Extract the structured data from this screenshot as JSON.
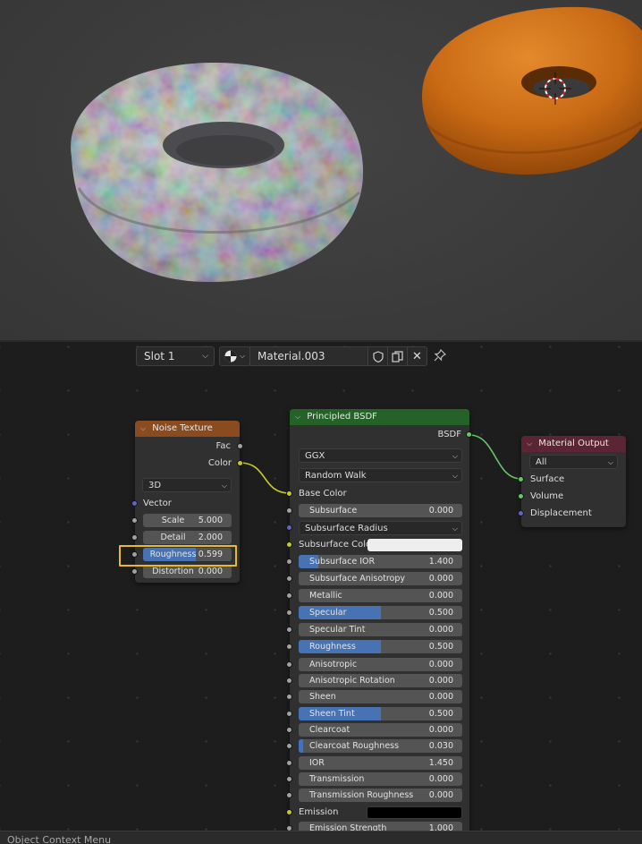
{
  "header": {
    "slot_label": "Slot 1",
    "material_name": "Material.003"
  },
  "noise_texture": {
    "title": "Noise Texture",
    "outputs": [
      "Fac",
      "Color"
    ],
    "dimensions": "3D",
    "vector_label": "Vector",
    "fields": [
      {
        "label": "Scale",
        "value": "5.000",
        "fill": 0
      },
      {
        "label": "Detail",
        "value": "2.000",
        "fill": 0
      },
      {
        "label": "Roughness",
        "value": "0.599",
        "fill": 0.599
      },
      {
        "label": "Distortion",
        "value": "0.000",
        "fill": 0
      }
    ]
  },
  "principled": {
    "title": "Principled BSDF",
    "output": "BSDF",
    "distribution": "GGX",
    "subsurface_method": "Random Walk",
    "base_color_label": "Base Color",
    "subsurface_radius_label": "Subsurface Radius",
    "subsurface_color_label": "Subsurface Color",
    "emission_label": "Emission",
    "fields": [
      {
        "label": "Subsurface",
        "value": "0.000",
        "fill": 0
      },
      {
        "label": "Subsurface IOR",
        "value": "1.400",
        "fill": 0.12
      },
      {
        "label": "Subsurface Anisotropy",
        "value": "0.000",
        "fill": 0
      },
      {
        "label": "Metallic",
        "value": "0.000",
        "fill": 0
      },
      {
        "label": "Specular",
        "value": "0.500",
        "fill": 0.5
      },
      {
        "label": "Specular Tint",
        "value": "0.000",
        "fill": 0
      },
      {
        "label": "Roughness",
        "value": "0.500",
        "fill": 0.5
      },
      {
        "label": "Anisotropic",
        "value": "0.000",
        "fill": 0
      },
      {
        "label": "Anisotropic Rotation",
        "value": "0.000",
        "fill": 0
      },
      {
        "label": "Sheen",
        "value": "0.000",
        "fill": 0
      },
      {
        "label": "Sheen Tint",
        "value": "0.500",
        "fill": 0.5
      },
      {
        "label": "Clearcoat",
        "value": "0.000",
        "fill": 0
      },
      {
        "label": "Clearcoat Roughness",
        "value": "0.030",
        "fill": 0.03
      },
      {
        "label": "IOR",
        "value": "1.450",
        "fill": 0
      },
      {
        "label": "Transmission",
        "value": "0.000",
        "fill": 0
      },
      {
        "label": "Transmission Roughness",
        "value": "0.000",
        "fill": 0
      },
      {
        "label": "Emission Strength",
        "value": "1.000",
        "fill": 0
      }
    ]
  },
  "material_output": {
    "title": "Material Output",
    "target": "All",
    "inputs": [
      "Surface",
      "Volume",
      "Displacement"
    ]
  },
  "status": {
    "text": "Object Context Menu"
  },
  "colors": {
    "noise_header": "#8a4c1f",
    "principled_header": "#246228",
    "output_header": "#5c2533",
    "slider_fill": "#4772b3",
    "highlight": "#e8b92a",
    "donut_orange": "#c96a14"
  }
}
